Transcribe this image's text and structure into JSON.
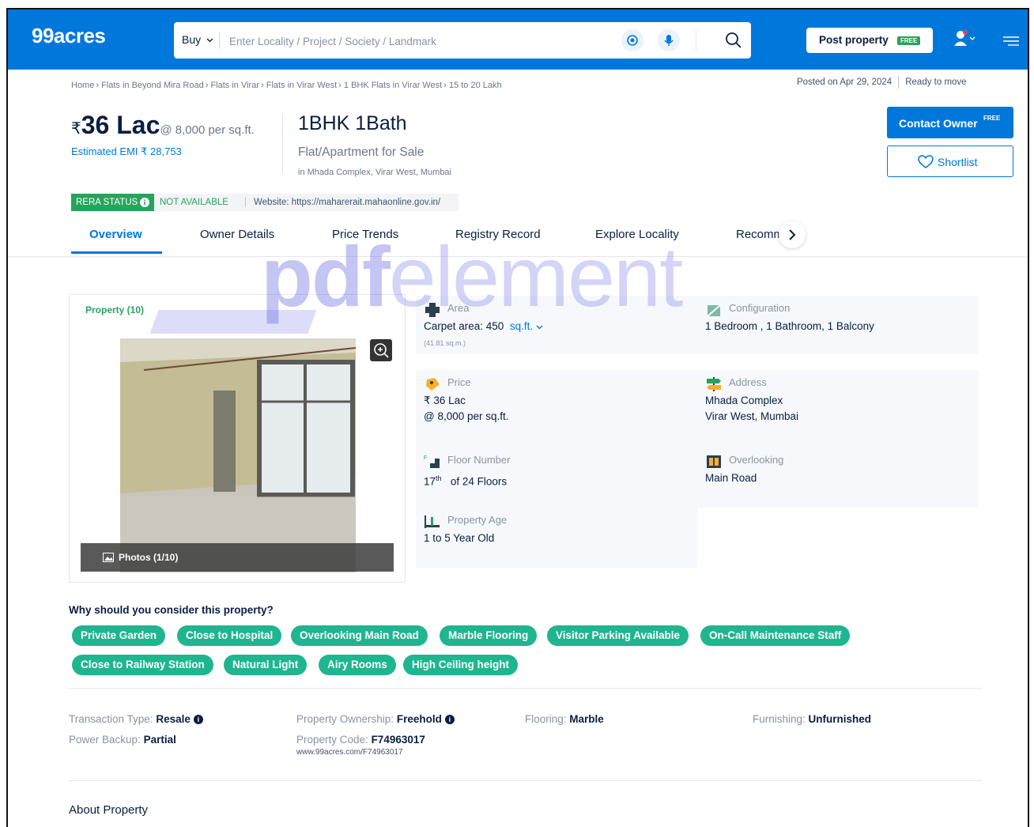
{
  "header": {
    "logo": "99acres",
    "buy_label": "Buy",
    "search_placeholder": "Enter Locality / Project / Society / Landmark",
    "post_property_label": "Post property",
    "free_badge": "FREE"
  },
  "breadcrumb": [
    "Home",
    "Flats in Beyond Mira Road",
    "Flats in Virar",
    "Flats in Virar West",
    "1 BHK Flats in Virar West",
    "15 to 20 Lakh"
  ],
  "meta": {
    "posted_on": "Posted on Apr 29, 2024",
    "status": "Ready to move"
  },
  "price": {
    "currency": "₹",
    "amount": "36 Lac",
    "rate": "@ 8,000 per sq.ft.",
    "emi": "Estimated EMI ₹ 28,753"
  },
  "listing": {
    "title": "1BHK 1Bath",
    "subtitle": "Flat/Apartment for Sale",
    "location": "in Mhada Complex, Virar West, Mumbai"
  },
  "actions": {
    "contact_owner": "Contact Owner",
    "contact_free": "FREE",
    "shortlist": "Shortlist"
  },
  "rera": {
    "tag": "RERA STATUS",
    "status": "NOT AVAILABLE",
    "website": "Website: https://maharerait.mahaonline.gov.in/"
  },
  "tabs": [
    "Overview",
    "Owner Details",
    "Price Trends",
    "Registry Record",
    "Explore Locality",
    "Recomm"
  ],
  "gallery": {
    "title": "Property (10)",
    "photos_label": "Photos (1/10)"
  },
  "details": {
    "area_label": "Area",
    "area_value": "Carpet area: 450",
    "area_unit": "sq.ft.",
    "area_sub": "(41.81 sq.m.)",
    "config_label": "Configuration",
    "config_value": "1 Bedroom , 1 Bathroom, 1 Balcony",
    "price_label": "Price",
    "price_value": "₹ 36 Lac",
    "price_rate": "@ 8,000 per sq.ft.",
    "address_label": "Address",
    "address_line1": "Mhada Complex",
    "address_line2": "Virar West, Mumbai",
    "floor_label": "Floor Number",
    "floor_num": "17",
    "floor_sup": "th",
    "floor_of": "of 24 Floors",
    "overlooking_label": "Overlooking",
    "overlooking_value": "Main Road",
    "age_label": "Property Age",
    "age_value": "1 to 5 Year Old"
  },
  "why": {
    "heading": "Why should you consider this property?",
    "chips": [
      "Private Garden",
      "Close to Hospital",
      "Overlooking Main Road",
      "Marble Flooring",
      "Visitor Parking Available",
      "On-Call Maintenance Staff",
      "Close to Railway Station",
      "Natural Light",
      "Airy Rooms",
      "High Ceiling height"
    ]
  },
  "facts": {
    "transaction_label": "Transaction Type",
    "transaction_value": "Resale",
    "ownership_label": "Property Ownership",
    "ownership_value": "Freehold",
    "flooring_label": "Flooring",
    "flooring_value": "Marble",
    "furnishing_label": "Furnishing",
    "furnishing_value": "Unfurnished",
    "power_label": "Power Backup",
    "power_value": "Partial",
    "code_label": "Property Code",
    "code_value": "F74963017",
    "code_url": "www.99acres.com/F74963017"
  },
  "about_heading": "About Property",
  "watermark": {
    "pdf": "pdf",
    "element": "element"
  },
  "colors": {
    "brand_blue": "#0078db",
    "chip_green": "#1fb58f",
    "rera_green": "#25a45c"
  }
}
